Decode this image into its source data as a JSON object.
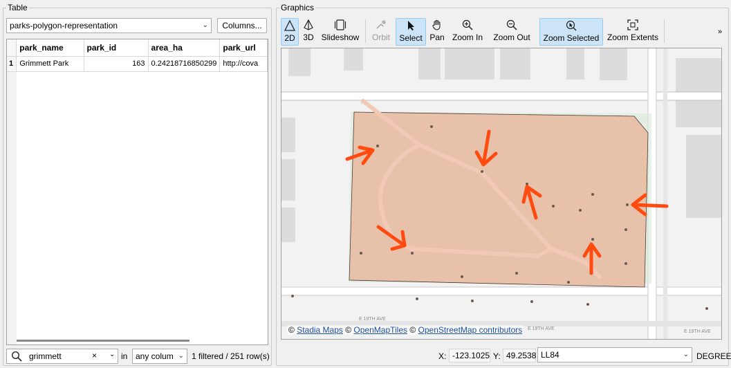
{
  "table_panel": {
    "title": "Table",
    "layer_select": "parks-polygon-representation",
    "columns_button": "Columns...",
    "headers": [
      "park_name",
      "park_id",
      "area_ha",
      "park_url"
    ],
    "rows": [
      {
        "index": "1",
        "park_name": "Grimmett Park",
        "park_id": "163",
        "area_ha": "0.24218716850299",
        "park_url": "http://cova"
      }
    ],
    "search": {
      "value": "grimmett",
      "clear_glyph": "×",
      "in_label": "in",
      "column_select": "any colum",
      "status": "1 filtered / 251 row(s)"
    }
  },
  "graphics_panel": {
    "title": "Graphics",
    "toolbar": {
      "b2d": "2D",
      "b3d": "3D",
      "slideshow": "Slideshow",
      "orbit": "Orbit",
      "select": "Select",
      "pan": "Pan",
      "zoom_in": "Zoom In",
      "zoom_out": "Zoom Out",
      "zoom_selected": "Zoom Selected",
      "zoom_extents": "Zoom Extents",
      "more": "»"
    },
    "map": {
      "street_label_1": "E 19TH AVE",
      "street_label_2": "E 19TH AVE",
      "street_label_3": "E 19TH AVE",
      "attribution": {
        "c1": "©",
        "stadia": "Stadia Maps",
        "c2": "©",
        "openmaptiles": "OpenMapTiles",
        "c3": "©",
        "osm": "OpenStreetMap contributors"
      },
      "colors": {
        "polygon_fill": "#e8b8a0",
        "polygon_stroke": "#4a3a30",
        "arrow": "#ff4a10",
        "building": "#dcdcdc",
        "road": "#ffffff"
      }
    },
    "status": {
      "x_label": "X:",
      "x_value": "-123.1025",
      "y_label": "Y:",
      "y_value": "49.2538",
      "crs": "LL84",
      "unit": "DEGREE"
    }
  }
}
